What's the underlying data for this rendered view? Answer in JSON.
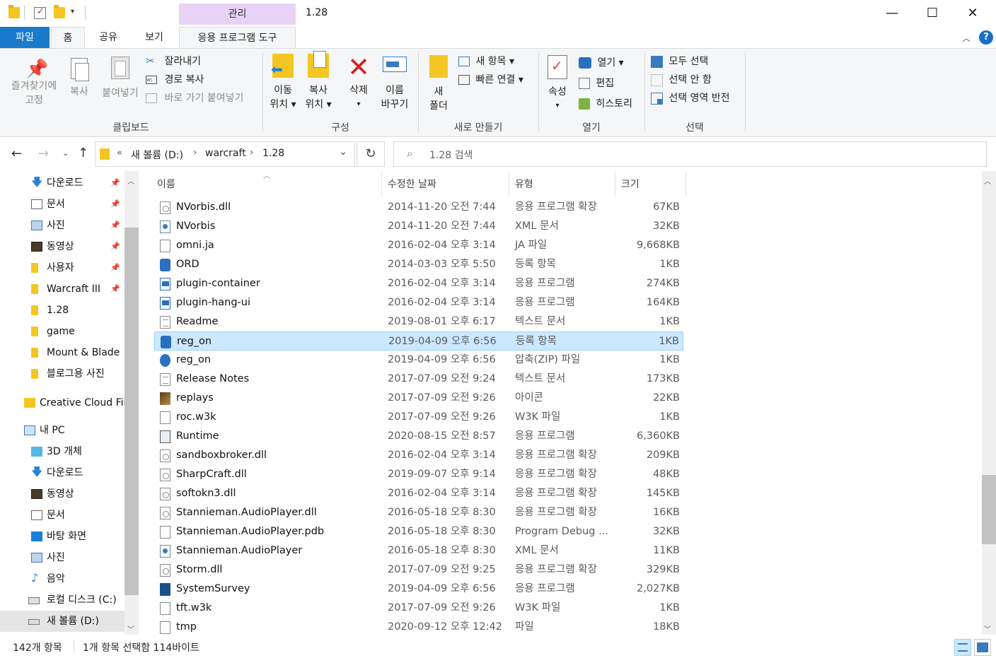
{
  "window": {
    "title": "1.28",
    "context_tab_header": "관리",
    "controls": {
      "minimize": "—",
      "maximize": "☐",
      "close": "✕"
    }
  },
  "tabs": {
    "file": "파일",
    "home": "홈",
    "share": "공유",
    "view": "보기",
    "app_tools": "응용 프로그램 도구"
  },
  "ribbon": {
    "clipboard": {
      "label": "클립보드",
      "pin": "즐겨찾기에\n고정",
      "pin_l1": "즐겨찾기에",
      "pin_l2": "고정",
      "copy": "복사",
      "paste": "붙여넣기",
      "cut": "잘라내기",
      "copy_path": "경로 복사",
      "paste_shortcut": "바로 가기 붙여넣기"
    },
    "organize": {
      "label": "구성",
      "move_l1": "이동",
      "move_l2": "위치 ▾",
      "copyto_l1": "복사",
      "copyto_l2": "위치 ▾",
      "delete": "삭제",
      "delete_arrow": "▾",
      "rename_l1": "이름",
      "rename_l2": "바꾸기"
    },
    "new": {
      "label": "새로 만들기",
      "folder_l1": "새",
      "folder_l2": "폴더",
      "new_item": "새 항목 ▾",
      "easy_access": "빠른 연결 ▾"
    },
    "open": {
      "label": "열기",
      "properties": "속성",
      "properties_arrow": "▾",
      "open": "열기 ▾",
      "edit": "편집",
      "history": "히스토리"
    },
    "select": {
      "label": "선택",
      "select_all": "모두 선택",
      "select_none": "선택 안 함",
      "invert": "선택 영역 반전"
    }
  },
  "address": {
    "crumbs": [
      "«",
      "새 볼륨 (D:)",
      "›",
      "warcraft",
      "›",
      "1.28"
    ],
    "search_placeholder": "1.28 검색"
  },
  "nav": {
    "items": [
      {
        "label": "다운로드",
        "pinned": true
      },
      {
        "label": "문서",
        "pinned": true
      },
      {
        "label": "사진",
        "pinned": true
      },
      {
        "label": "동영상",
        "pinned": true
      },
      {
        "label": "사용자",
        "pinned": true
      },
      {
        "label": "Warcraft III",
        "pinned": true
      },
      {
        "label": "1.28",
        "pinned": false
      },
      {
        "label": "game",
        "pinned": false
      },
      {
        "label": "Mount & Blade",
        "pinned": false
      },
      {
        "label": "블로그용 사진",
        "pinned": false
      },
      {
        "label": "Creative Cloud Fil",
        "pinned": false
      },
      {
        "label": "내 PC",
        "pinned": false
      },
      {
        "label": "3D 개체",
        "pinned": false
      },
      {
        "label": "다운로드",
        "pinned": false
      },
      {
        "label": "동영상",
        "pinned": false
      },
      {
        "label": "문서",
        "pinned": false
      },
      {
        "label": "바탕 화면",
        "pinned": false
      },
      {
        "label": "사진",
        "pinned": false
      },
      {
        "label": "음악",
        "pinned": false
      },
      {
        "label": "로컬 디스크 (C:)",
        "pinned": false
      },
      {
        "label": "새 볼륨 (D:)",
        "pinned": false
      }
    ]
  },
  "columns": {
    "name": "이름",
    "date": "수정한 날짜",
    "type": "유형",
    "size": "크기"
  },
  "files": [
    {
      "name": "NVorbis.dll",
      "date": "2014-11-20 오전 7:44",
      "type": "응용 프로그램 확장",
      "size": "67KB",
      "icon": "dll"
    },
    {
      "name": "NVorbis",
      "date": "2014-11-20 오전 7:44",
      "type": "XML 문서",
      "size": "32KB",
      "icon": "xml"
    },
    {
      "name": "omni.ja",
      "date": "2016-02-04 오후 3:14",
      "type": "JA 파일",
      "size": "9,668KB",
      "icon": "blank"
    },
    {
      "name": "ORD",
      "date": "2014-03-03 오후 5:50",
      "type": "등록 항목",
      "size": "1KB",
      "icon": "reg"
    },
    {
      "name": "plugin-container",
      "date": "2016-02-04 오후 3:14",
      "type": "응용 프로그램",
      "size": "274KB",
      "icon": "exe"
    },
    {
      "name": "plugin-hang-ui",
      "date": "2016-02-04 오후 3:14",
      "type": "응용 프로그램",
      "size": "164KB",
      "icon": "exe"
    },
    {
      "name": "Readme",
      "date": "2019-08-01 오후 6:17",
      "type": "텍스트 문서",
      "size": "1KB",
      "icon": "txt"
    },
    {
      "name": "reg_on",
      "date": "2019-04-09 오후 6:56",
      "type": "등록 항목",
      "size": "1KB",
      "icon": "reg",
      "selected": true
    },
    {
      "name": "reg_on",
      "date": "2019-04-09 오후 6:56",
      "type": "압축(ZIP) 파일",
      "size": "1KB",
      "icon": "zip"
    },
    {
      "name": "Release Notes",
      "date": "2017-07-09 오전 9:24",
      "type": "텍스트 문서",
      "size": "173KB",
      "icon": "txt"
    },
    {
      "name": "replays",
      "date": "2017-07-09 오전 9:26",
      "type": "아이콘",
      "size": "22KB",
      "icon": "img"
    },
    {
      "name": "roc.w3k",
      "date": "2017-07-09 오전 9:26",
      "type": "W3K 파일",
      "size": "1KB",
      "icon": "blank"
    },
    {
      "name": "Runtime",
      "date": "2020-08-15 오전 8:57",
      "type": "응용 프로그램",
      "size": "6,360KB",
      "icon": "rt"
    },
    {
      "name": "sandboxbroker.dll",
      "date": "2016-02-04 오후 3:14",
      "type": "응용 프로그램 확장",
      "size": "209KB",
      "icon": "dll"
    },
    {
      "name": "SharpCraft.dll",
      "date": "2019-09-07 오후 9:14",
      "type": "응용 프로그램 확장",
      "size": "48KB",
      "icon": "dll"
    },
    {
      "name": "softokn3.dll",
      "date": "2016-02-04 오후 3:14",
      "type": "응용 프로그램 확장",
      "size": "145KB",
      "icon": "dll"
    },
    {
      "name": "Stannieman.AudioPlayer.dll",
      "date": "2016-05-18 오후 8:30",
      "type": "응용 프로그램 확장",
      "size": "16KB",
      "icon": "dll"
    },
    {
      "name": "Stannieman.AudioPlayer.pdb",
      "date": "2016-05-18 오후 8:30",
      "type": "Program Debug ...",
      "size": "32KB",
      "icon": "blank"
    },
    {
      "name": "Stannieman.AudioPlayer",
      "date": "2016-05-18 오후 8:30",
      "type": "XML 문서",
      "size": "11KB",
      "icon": "xml"
    },
    {
      "name": "Storm.dll",
      "date": "2017-07-09 오전 9:25",
      "type": "응용 프로그램 확장",
      "size": "329KB",
      "icon": "dll"
    },
    {
      "name": "SystemSurvey",
      "date": "2019-04-09 오후 6:56",
      "type": "응용 프로그램",
      "size": "2,027KB",
      "icon": "ss"
    },
    {
      "name": "tft.w3k",
      "date": "2017-07-09 오전 9:26",
      "type": "W3K 파일",
      "size": "1KB",
      "icon": "blank"
    },
    {
      "name": "tmp",
      "date": "2020-09-12 오후 12:42",
      "type": "파일",
      "size": "18KB",
      "icon": "blank"
    }
  ],
  "status": {
    "count": "142개 항목",
    "selection": "1개 항목 선택함 114바이트"
  },
  "colors": {
    "accent": "#1979ca",
    "selection": "#cce8ff",
    "context_tab": "#e8d2f5"
  }
}
